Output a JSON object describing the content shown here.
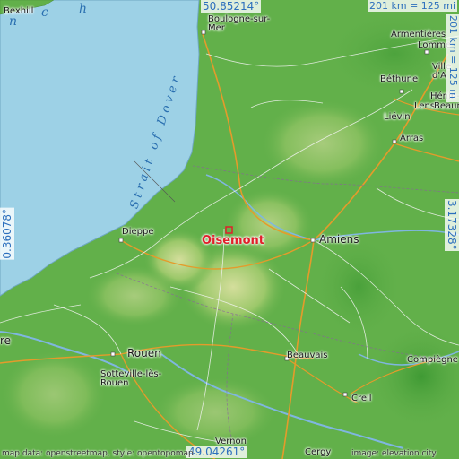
{
  "map": {
    "focus_city": "Oisemont",
    "cities": {
      "bexhill": "Bexhill",
      "boulogne": "Boulogne-sur-\nMer",
      "armentieres": "Armentières",
      "lomme": "Lomme",
      "ville": "Ville\nd'A",
      "bethune": "Béthune",
      "henin": "Hénin-",
      "lens": "Lens",
      "beaumont": "Beaumont",
      "lievin": "Liévin",
      "arras": "Arras",
      "dieppe": "Dieppe",
      "amiens": "Amiens",
      "rouen": "Rouen",
      "sotteville": "Sotteville-lès-\nRouen",
      "beauvais": "Beauvais",
      "compiegne": "Compiègne",
      "creil": "Creil",
      "vernon": "Vernon",
      "cergy": "Cergy",
      "havre": "re"
    },
    "sea_labels": {
      "channel_n": "n",
      "channel_c": "c",
      "channel_h": "h",
      "strait": "Strait of Dover"
    },
    "coords": {
      "top": "50.85214°",
      "bottom": "49.04261°",
      "left": "0.36078°",
      "right": "3.17328°"
    },
    "scale": {
      "horizontal": "201 km = 125 mi",
      "vertical": "201 km = 125 mi"
    },
    "attribution_left": "map data: openstreetmap, style: opentopomap",
    "attribution_right": "image: elevation.city",
    "colors": {
      "sea": "#9dd1e6",
      "lowland": "#4fa43a",
      "midland": "#7dbd56",
      "highland": "#c3d88f",
      "focus": "#e0202a",
      "coord_text": "#2c6fbd"
    }
  }
}
